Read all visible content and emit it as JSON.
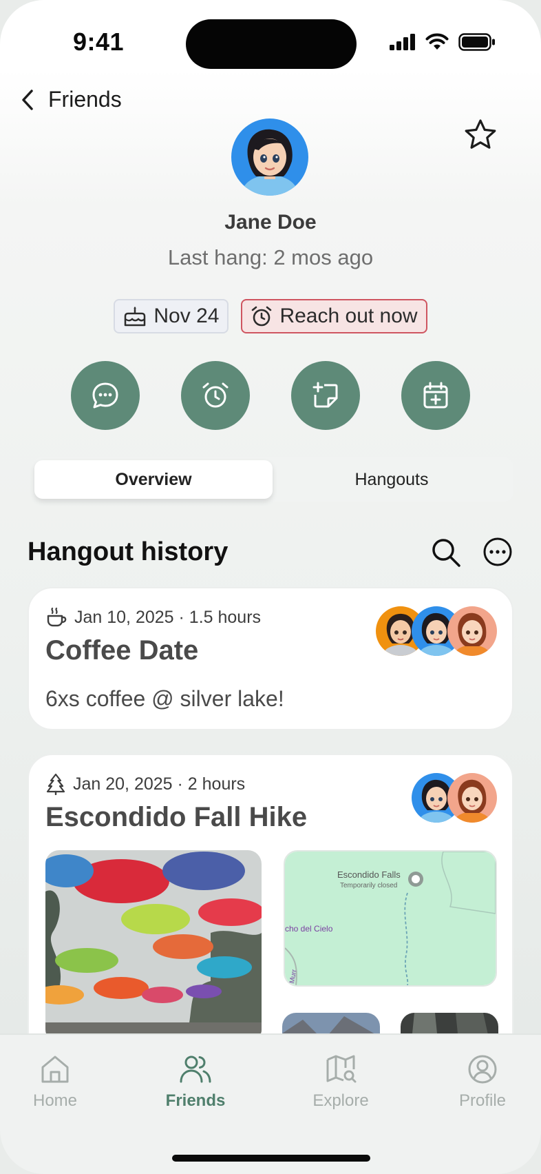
{
  "status_bar": {
    "time": "9:41"
  },
  "nav": {
    "back_label": "Friends"
  },
  "profile": {
    "name": "Jane Doe",
    "last_hang": "Last hang: 2 mos ago"
  },
  "chips": {
    "birthday": "Nov 24",
    "reach_out": "Reach out now"
  },
  "quick_actions": [
    "message-icon",
    "alarm-icon",
    "note-add-icon",
    "calendar-add-icon"
  ],
  "tabs": {
    "overview": "Overview",
    "hangouts": "Hangouts",
    "active": "Overview"
  },
  "history": {
    "title": "Hangout history",
    "cards": [
      {
        "icon": "coffee-icon",
        "meta": "Jan 10, 2025 · 1.5 hours",
        "title": "Coffee Date",
        "note": "6xs coffee @ silver lake!"
      },
      {
        "icon": "tree-icon",
        "meta": "Jan 20, 2025 · 2 hours",
        "title": "Escondido Fall Hike",
        "map": {
          "place": "Escondido Falls",
          "status": "Temporarily closed",
          "road": "cho del Cielo",
          "road2": "Murr"
        }
      }
    ]
  },
  "bottom_nav": {
    "items": [
      {
        "label": "Home",
        "icon": "home-icon"
      },
      {
        "label": "Friends",
        "icon": "friends-icon"
      },
      {
        "label": "Explore",
        "icon": "map-search-icon"
      },
      {
        "label": "Profile",
        "icon": "profile-icon"
      }
    ],
    "active": "Friends"
  },
  "colors": {
    "accent": "#5e8a78",
    "accent_text": "#4f7f6c",
    "reach_border": "#cf5560",
    "reach_bg": "#f7e4e4"
  }
}
